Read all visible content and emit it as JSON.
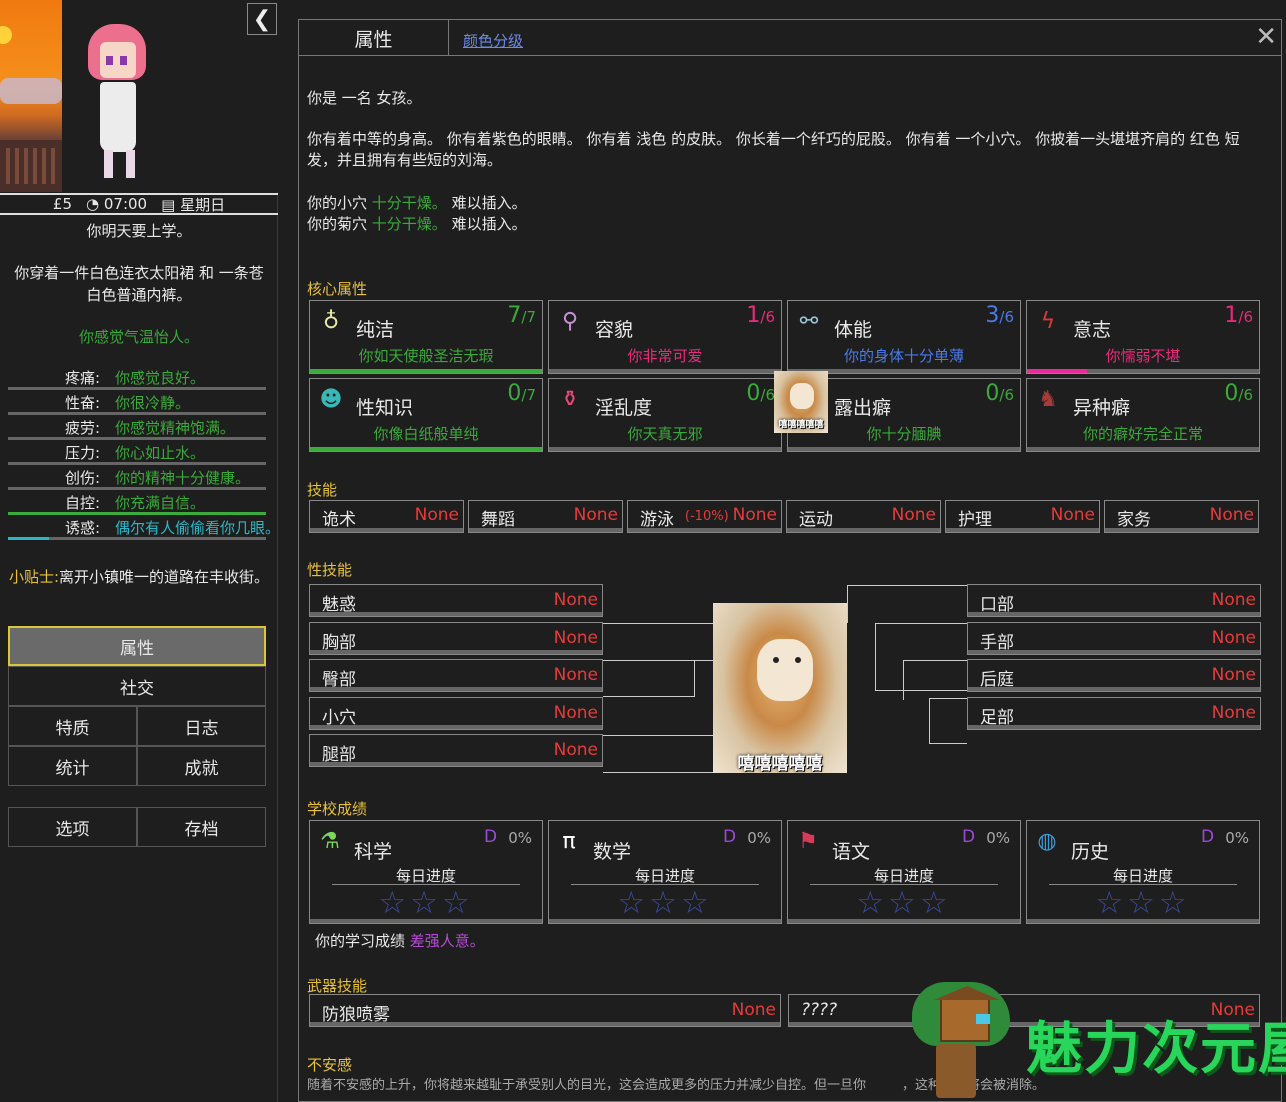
{
  "sidebar": {
    "money": "£5",
    "time": "07:00",
    "weekday": "星期日",
    "school_line": "你明天要上学。",
    "clothes_line": "你穿着一件白色连衣太阳裙 和 一条苍白色普通内裤。",
    "mood_line": "你感觉气温怡人。",
    "statuses": [
      {
        "label": "疼痛:",
        "value": "你感觉良好。",
        "fill": 0,
        "color": "#3aaa3a"
      },
      {
        "label": "性奋:",
        "value": "你很冷静。",
        "fill": 0,
        "color": "#3aaa3a"
      },
      {
        "label": "疲劳:",
        "value": "你感觉精神饱满。",
        "fill": 0,
        "color": "#3aaa3a"
      },
      {
        "label": "压力:",
        "value": "你心如止水。",
        "fill": 0,
        "color": "#3aaa3a"
      },
      {
        "label": "创伤:",
        "value": "你的精神十分健康。",
        "fill": 0,
        "color": "#3aaa3a"
      },
      {
        "label": "自控:",
        "value": "你充满自信。",
        "fill": 1.0,
        "color": "#3aaa3a"
      },
      {
        "label": "诱惑:",
        "value": "偶尔有人偷偷看你几眼。",
        "fill": 0.16,
        "color": "#2ab8c8"
      }
    ],
    "tip_key": "小贴士:",
    "tip_text": "离开小镇唯一的道路在丰收街。",
    "nav": {
      "attributes": "属性",
      "social": "社交",
      "traits": "特质",
      "journal": "日志",
      "stats": "统计",
      "achievements": "成就",
      "options": "选项",
      "saves": "存档"
    }
  },
  "panel": {
    "tab_attr": "属性",
    "tab_color": "颜色分级",
    "intro": "你是 一名 女孩。",
    "appearance": "你有着中等的身高。 你有着紫色的眼睛。 你有着 浅色 的皮肤。 你长着一个纤巧的屁股。 你有着 一个小穴。 你披着一头堪堪齐肩的 红色 短发，并且拥有有些短的刘海。",
    "vagina_prefix": "你的小穴",
    "vagina_state": "十分干燥。",
    "vagina_suffix": "难以插入。",
    "anus_prefix": "你的菊穴",
    "anus_state": "十分干燥。",
    "anus_suffix": "难以插入。",
    "core_title": "核心属性",
    "core": [
      {
        "name": "纯洁",
        "score": "7",
        "max": "/7",
        "desc": "你如天使般圣洁无瑕",
        "desc_color": "#3aaa3a",
        "score_color": "#3aaa3a",
        "fill": 1.0,
        "fill_color": "#3aaa3a",
        "icon": "halo-icon",
        "glyph": "♁",
        "icon_color": "#e8e8a8"
      },
      {
        "name": "容貌",
        "score": "1",
        "max": "/6",
        "desc": "你非常可爱",
        "desc_color": "#e82a7a",
        "score_color": "#e82a7a",
        "fill": 0,
        "fill_color": "#e82a7a",
        "icon": "mirror-icon",
        "glyph": "⚲",
        "icon_color": "#c890d8"
      },
      {
        "name": "体能",
        "score": "3",
        "max": "/6",
        "desc": "你的身体十分单薄",
        "desc_color": "#4a7ae8",
        "score_color": "#4a7ae8",
        "fill": 0,
        "fill_color": "#4a7ae8",
        "icon": "dumbbell-icon",
        "glyph": "⚯",
        "icon_color": "#9ac8d8"
      },
      {
        "name": "意志",
        "score": "1",
        "max": "/6",
        "desc": "你懦弱不堪",
        "desc_color": "#e82a7a",
        "score_color": "#e82a7a",
        "fill": 0.26,
        "fill_color": "#e82a9a",
        "icon": "lightning-icon",
        "glyph": "ϟ",
        "icon_color": "#d83a3a"
      },
      {
        "name": "性知识",
        "score": "0",
        "max": "/7",
        "desc": "你像白纸般单纯",
        "desc_color": "#3aaa3a",
        "score_color": "#3aaa3a",
        "fill": 1.0,
        "fill_color": "#3aaa3a",
        "icon": "head-icon",
        "glyph": "☻",
        "icon_color": "#3ab8b8"
      },
      {
        "name": "淫乱度",
        "score": "0",
        "max": "/6",
        "desc": "你天真无邪",
        "desc_color": "#3aaa3a",
        "score_color": "#3aaa3a",
        "fill": 0,
        "fill_color": "#3aaa3a",
        "icon": "potion-icon",
        "glyph": "⚱",
        "icon_color": "#e84a7a"
      },
      {
        "name": "露出癖",
        "score": "0",
        "max": "/6",
        "desc": "你十分腼腆",
        "desc_color": "#3aaa3a",
        "score_color": "#3aaa3a",
        "fill": 0,
        "fill_color": "#3aaa3a",
        "icon": "doge-icon",
        "glyph": "",
        "icon_color": "#c98a48"
      },
      {
        "name": "异种癖",
        "score": "0",
        "max": "/6",
        "desc": "你的癖好完全正常",
        "desc_color": "#3aaa3a",
        "score_color": "#3aaa3a",
        "fill": 0,
        "fill_color": "#3aaa3a",
        "icon": "dog-icon",
        "glyph": "♞",
        "icon_color": "#a83a3a"
      }
    ],
    "skills_title": "技能",
    "skills": [
      {
        "name": "诡术",
        "value": "None",
        "mod": ""
      },
      {
        "name": "舞蹈",
        "value": "None",
        "mod": ""
      },
      {
        "name": "游泳",
        "value": "None",
        "mod": "(-10%)"
      },
      {
        "name": "运动",
        "value": "None",
        "mod": ""
      },
      {
        "name": "护理",
        "value": "None",
        "mod": ""
      },
      {
        "name": "家务",
        "value": "None",
        "mod": ""
      }
    ],
    "sex_title": "性技能",
    "sex_left": [
      {
        "name": "魅惑",
        "value": "None"
      },
      {
        "name": "胸部",
        "value": "None"
      },
      {
        "name": "臀部",
        "value": "None"
      },
      {
        "name": "小穴",
        "value": "None"
      },
      {
        "name": "腿部",
        "value": "None"
      }
    ],
    "sex_right": [
      {
        "name": "口部",
        "value": "None"
      },
      {
        "name": "手部",
        "value": "None"
      },
      {
        "name": "后庭",
        "value": "None"
      },
      {
        "name": "足部",
        "value": "None"
      }
    ],
    "doge_caption_big": "嘻嘻嘻嘻嘻",
    "doge_caption_small": "嘻嘻嘻嘻嘻",
    "school_title": "学校成绩",
    "school": [
      {
        "name": "科学",
        "grade": "D",
        "pct": "0%",
        "daily": "每日进度",
        "icon": "flask-icon",
        "glyph": "⚗",
        "icon_color": "#7ad85a"
      },
      {
        "name": "数学",
        "grade": "D",
        "pct": "0%",
        "daily": "每日进度",
        "icon": "pi-icon",
        "glyph": "π",
        "icon_color": "#ffffff"
      },
      {
        "name": "语文",
        "grade": "D",
        "pct": "0%",
        "daily": "每日进度",
        "icon": "uk-flag-icon",
        "glyph": "⚑",
        "icon_color": "#d83a5a"
      },
      {
        "name": "历史",
        "grade": "D",
        "pct": "0%",
        "daily": "每日进度",
        "icon": "globe-icon",
        "glyph": "◍",
        "icon_color": "#3a9ad8"
      }
    ],
    "stars": "☆☆☆",
    "school_summary_prefix": "你的学习成绩",
    "school_summary_value": "差强人意。",
    "weapon_title": "武器技能",
    "weapon_name": "防狼喷雾",
    "weapon_value": "None",
    "unknown_name": "????",
    "unknown_value": "None",
    "insecure_title": "不安感",
    "insecure_desc": "随着不安感的上升，你将越来越耻于承受别人的目光，这会造成更多的压力并减少自控。但一旦你",
    "insecure_desc_tail": "，这种影响将会被消除。"
  },
  "watermark": "魅力次元屋"
}
